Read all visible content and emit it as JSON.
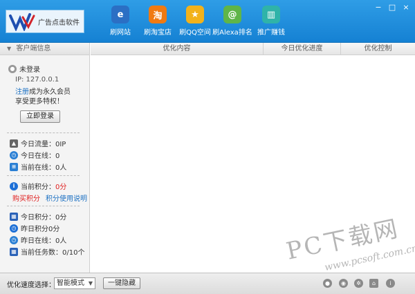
{
  "app": {
    "logo_text": "广告点击软件"
  },
  "toolbar": [
    {
      "label": "刷网站",
      "icon": "globe-icon",
      "glyph": "e",
      "color": "#2b6fc4"
    },
    {
      "label": "刷淘宝店",
      "icon": "taobao-icon",
      "glyph": "淘",
      "color": "#f07a12"
    },
    {
      "label": "刷QQ空间",
      "icon": "star-icon",
      "glyph": "★",
      "color": "#f2b21b"
    },
    {
      "label": "刷Alexa排名",
      "icon": "at-icon",
      "glyph": "@",
      "color": "#5fb548"
    },
    {
      "label": "推广赚钱",
      "icon": "chart-icon",
      "glyph": "▥",
      "color": "#2fb3a9"
    }
  ],
  "window": {
    "minimize": "−",
    "maximize": "□",
    "close": "×"
  },
  "sidebar": {
    "header": "客户端信息",
    "status": "未登录",
    "ip": "IP: 127.0.0.1",
    "register_link": "注册",
    "register_text": "成为永久会员",
    "privilege": "享受更多特权！",
    "login_button": "立即登录",
    "stats": {
      "traffic": "今日流量：0IP",
      "online_today": "今日在线：0",
      "online_now": "当前在线：0人",
      "points_now_label": "当前积分：",
      "points_now_value": "0分",
      "buy_points": "购买积分",
      "points_help": "积分使用说明",
      "points_today": "今日积分：0分",
      "points_yesterday": "昨日积分0分",
      "online_yesterday": "昨日在线：0人",
      "tasks_now": "当前任务数：0/10个"
    }
  },
  "table": {
    "columns": [
      "优化内容",
      "今日优化进度",
      "优化控制"
    ]
  },
  "bottom": {
    "speed_label": "优化速度选择：",
    "speed_value": "智能模式",
    "hide_button": "一键隐藏"
  },
  "watermark": {
    "main": "PC下载网",
    "sub": "www.pcsoft.com.cn"
  },
  "colors": {
    "header_blue": "#1e8fdc",
    "accent_red": "#e02020",
    "link_blue": "#1a6fc2"
  }
}
